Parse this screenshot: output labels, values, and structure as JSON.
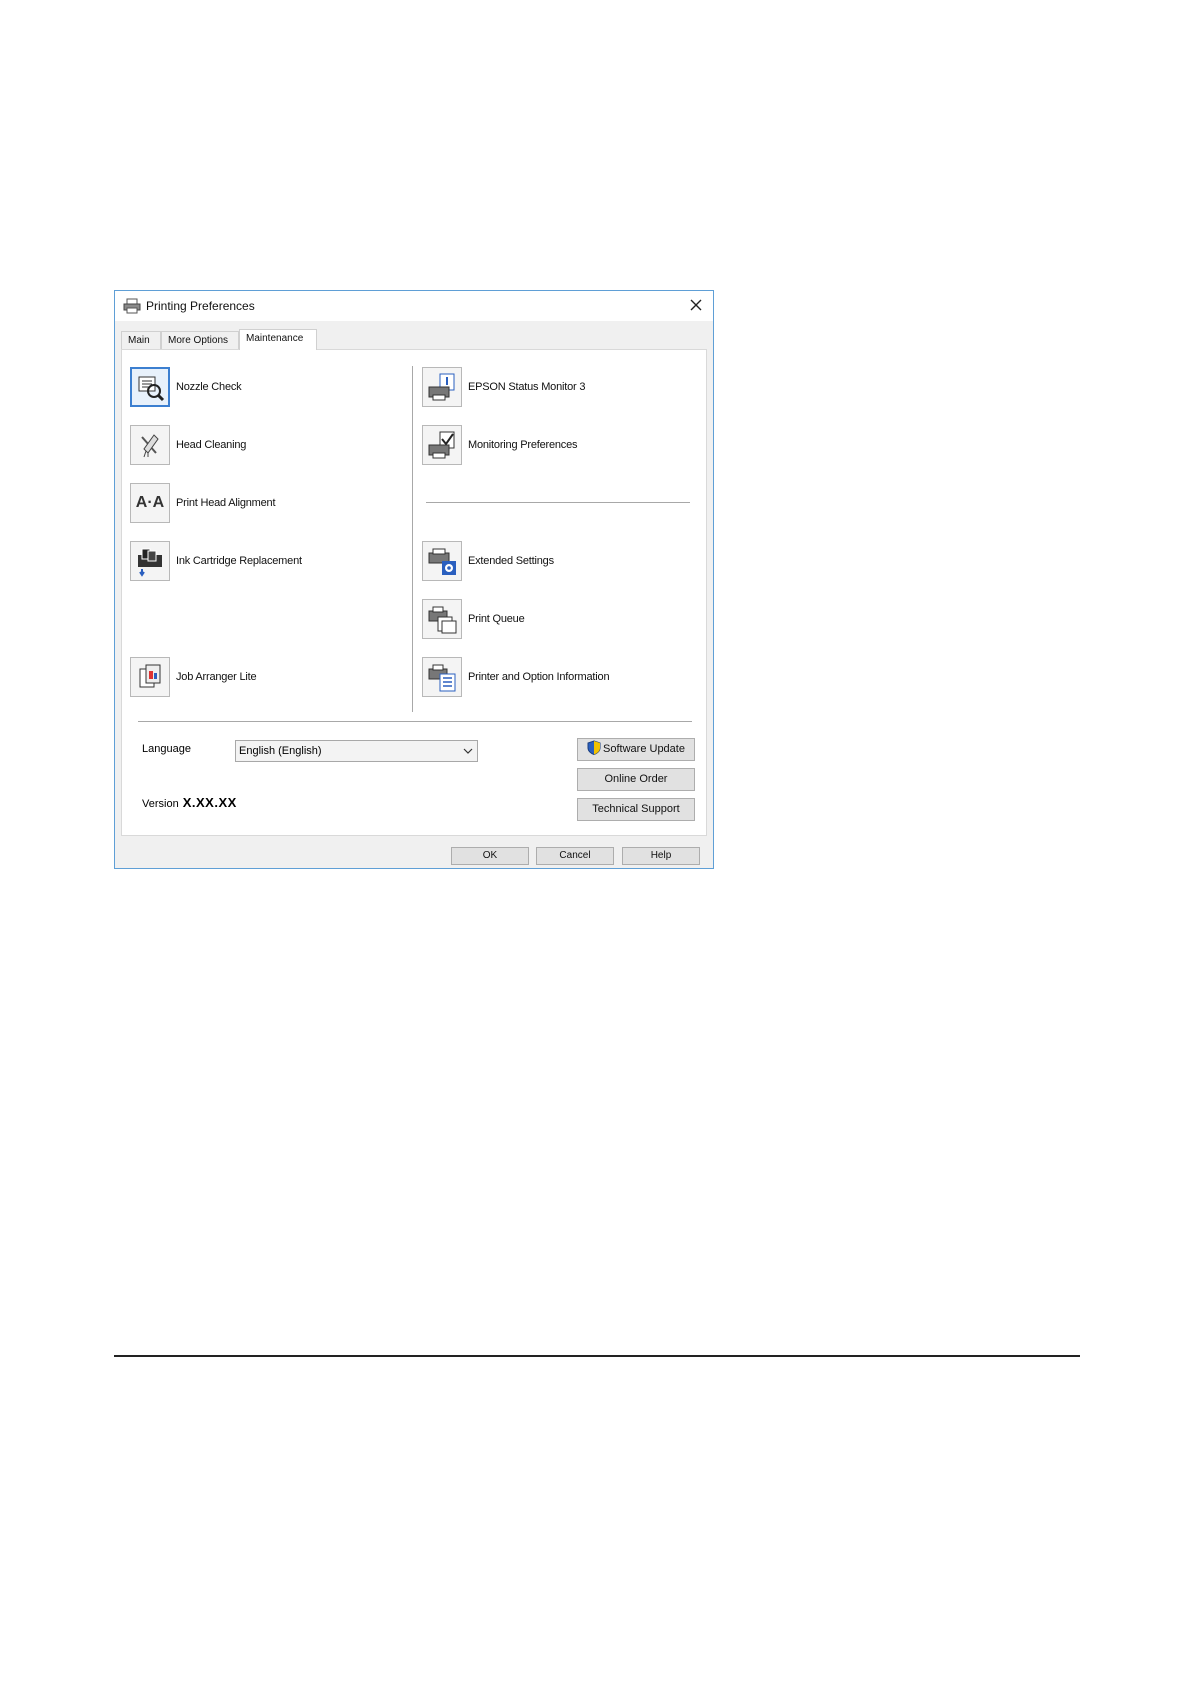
{
  "window": {
    "title": "Printing Preferences"
  },
  "tabs": [
    {
      "label": "Main"
    },
    {
      "label": "More Options"
    },
    {
      "label": "Maintenance"
    }
  ],
  "maintenance": {
    "left_items": [
      {
        "label": "Nozzle Check",
        "icon": "nozzle-check-icon"
      },
      {
        "label": "Head Cleaning",
        "icon": "head-cleaning-icon"
      },
      {
        "label": "Print Head Alignment",
        "icon": "print-head-alignment-icon"
      },
      {
        "label": "Ink Cartridge Replacement",
        "icon": "ink-cartridge-icon"
      },
      {
        "label": "Job Arranger Lite",
        "icon": "job-arranger-icon"
      }
    ],
    "right_items": [
      {
        "label": "EPSON Status Monitor 3",
        "icon": "status-monitor-icon"
      },
      {
        "label": "Monitoring Preferences",
        "icon": "monitoring-preferences-icon"
      },
      {
        "label": "Extended Settings",
        "icon": "extended-settings-icon"
      },
      {
        "label": "Print Queue",
        "icon": "print-queue-icon"
      },
      {
        "label": "Printer and Option Information",
        "icon": "printer-info-icon"
      }
    ]
  },
  "language": {
    "label": "Language",
    "selected": "English (English)"
  },
  "version": {
    "label": "Version",
    "value": "X.XX.XX"
  },
  "side_buttons": {
    "software_update": "Software Update",
    "online_order": "Online Order",
    "technical_support": "Technical Support"
  },
  "footer_buttons": {
    "ok": "OK",
    "cancel": "Cancel",
    "help": "Help"
  },
  "colors": {
    "accent": "#3c7fd0",
    "dialog_border": "#5f9fd6",
    "button_bg": "#e1e1e1"
  }
}
